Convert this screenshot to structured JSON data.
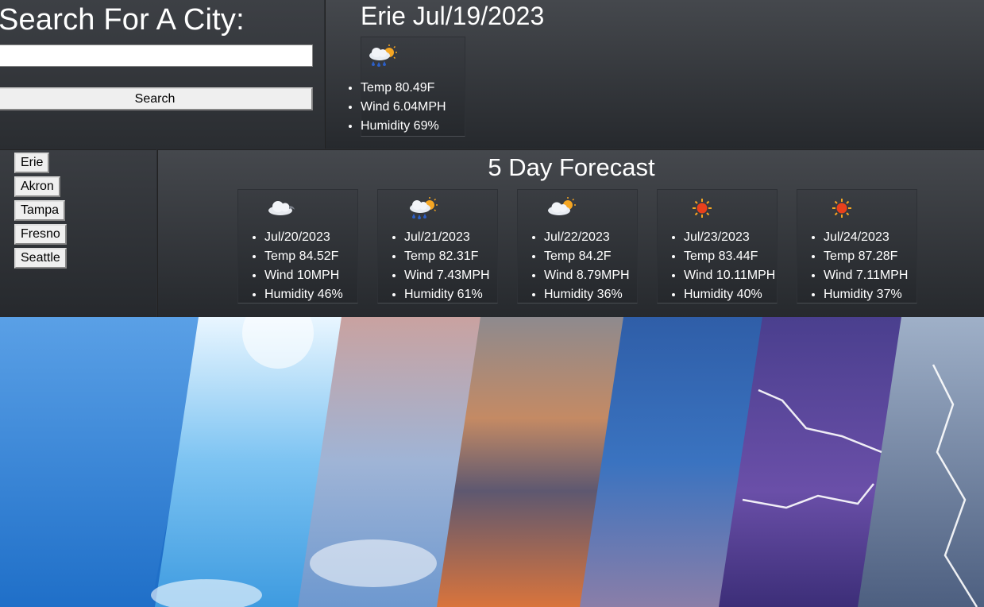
{
  "search": {
    "heading": "Search For A City:",
    "input_value": "",
    "button_label": "Search"
  },
  "current": {
    "title": "Erie Jul/19/2023",
    "icon": "rain-sun-icon",
    "temp": "Temp 80.49F",
    "wind": "Wind 6.04MPH",
    "humidity": "Humidity 69%"
  },
  "history": {
    "cities": [
      "Erie",
      "Akron",
      "Tampa",
      "Fresno",
      "Seattle"
    ]
  },
  "forecast": {
    "heading": "5 Day Forecast",
    "days": [
      {
        "icon": "cloud-icon",
        "date": "Jul/20/2023",
        "temp": "Temp 84.52F",
        "wind": "Wind 10MPH",
        "humidity": "Humidity 46%"
      },
      {
        "icon": "rain-sun-icon",
        "date": "Jul/21/2023",
        "temp": "Temp 82.31F",
        "wind": "Wind 7.43MPH",
        "humidity": "Humidity 61%"
      },
      {
        "icon": "partly-cloudy-icon",
        "date": "Jul/22/2023",
        "temp": "Temp 84.2F",
        "wind": "Wind 8.79MPH",
        "humidity": "Humidity 36%"
      },
      {
        "icon": "sun-icon",
        "date": "Jul/23/2023",
        "temp": "Temp 83.44F",
        "wind": "Wind 10.11MPH",
        "humidity": "Humidity 40%"
      },
      {
        "icon": "sun-icon",
        "date": "Jul/24/2023",
        "temp": "Temp 87.28F",
        "wind": "Wind 7.11MPH",
        "humidity": "Humidity 37%"
      }
    ]
  },
  "colors": {
    "panel_dark": "#2a2d31",
    "panel_light": "#45484d",
    "button_bg": "#efefef"
  }
}
